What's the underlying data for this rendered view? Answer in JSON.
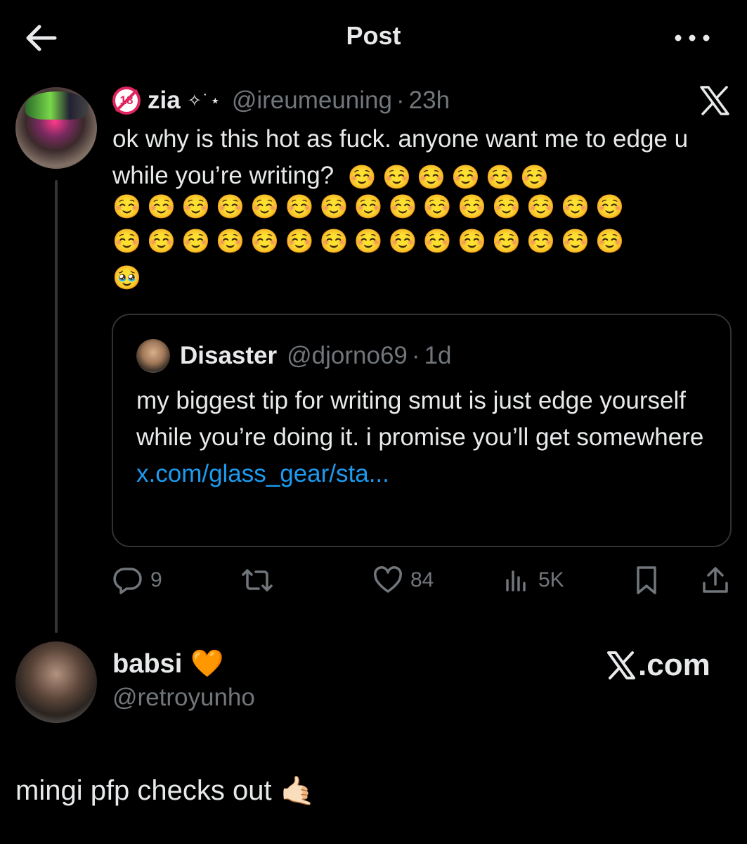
{
  "header": {
    "title": "Post"
  },
  "icons": {
    "back": "arrow-left-icon",
    "more": "more-horizontal-icon",
    "x_logo": "x-logo-icon",
    "reply": "reply-bubble-icon",
    "repost": "repost-icon",
    "like": "heart-outline-icon",
    "views": "views-bar-icon",
    "bookmark": "bookmark-icon",
    "share": "share-upload-icon"
  },
  "colors": {
    "background": "#000000",
    "text": "#e7e9ea",
    "muted": "#71767b",
    "link": "#1d9bf0",
    "border": "#2f3336",
    "heart_orange": "#ff8a1e",
    "badge_red": "#e0245e"
  },
  "post": {
    "badge": "18",
    "author_name": "zia",
    "decoration": "✧˙⋆",
    "handle": "@ireumeuning",
    "separator": "·",
    "time": "23h",
    "text": "ok why is this hot as fuck. anyone want me to edge u while you’re writing?",
    "emojis_inline": [
      "☺️",
      "☺️",
      "☺️",
      "☺️",
      "☺️",
      "☺️"
    ],
    "emoji_rows": [
      [
        "☺️",
        "☺️",
        "☺️",
        "☺️",
        "☺️",
        "☺️",
        "☺️",
        "☺️",
        "☺️",
        "☺️",
        "☺️",
        "☺️",
        "☺️",
        "☺️",
        "☺️"
      ],
      [
        "☺️",
        "☺️",
        "☺️",
        "☺️",
        "☺️",
        "☺️",
        "☺️",
        "☺️",
        "☺️",
        "☺️",
        "☺️",
        "☺️",
        "☺️",
        "☺️",
        "☺️"
      ],
      [
        "🥹"
      ]
    ],
    "quote": {
      "author_name": "Disaster",
      "handle": "@djorno69",
      "separator": "·",
      "time": "1d",
      "text": "my biggest tip for writing smut is just edge yourself while you’re doing it. i promise you’ll get somewhere ",
      "link": "x.com/glass_gear/sta..."
    },
    "actions": {
      "replies": "9",
      "reposts": "",
      "likes": "84",
      "views": "5K"
    }
  },
  "attribution": {
    "name": "babsi",
    "heart": "🧡",
    "handle": "@retroyunho",
    "site": ".com"
  },
  "comment": {
    "text": "mingi pfp checks out",
    "emoji": "🤙🏻"
  }
}
